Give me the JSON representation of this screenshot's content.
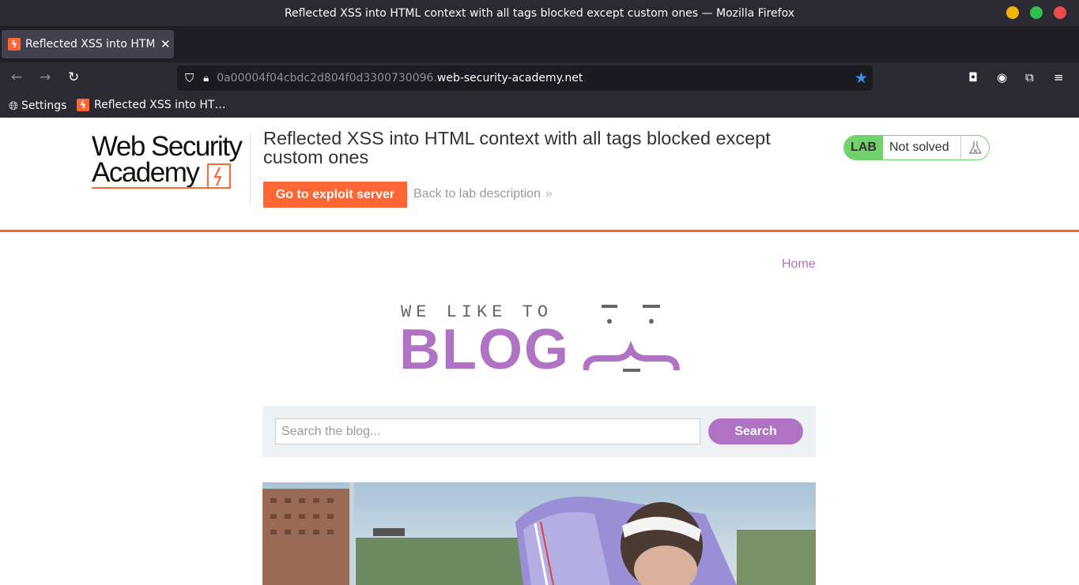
{
  "window": {
    "title": "Reflected XSS into HTML context with all tags blocked except custom ones — Mozilla Firefox"
  },
  "tabs": [
    {
      "label": "Reflected XSS into HTML",
      "active": true
    }
  ],
  "urlbar": {
    "subdomain": "0a00004f04cbdc2d804f0d3300730096.",
    "domain": "web-security-academy.net"
  },
  "bookmarks": [
    {
      "label": "Settings",
      "icon": "globe-icon"
    },
    {
      "label": "Reflected XSS into HT…",
      "icon": "academy-favicon"
    }
  ],
  "lab": {
    "logo_line1": "Web Security",
    "logo_line2": "Academy",
    "title": "Reflected XSS into HTML context with all tags blocked except custom ones",
    "exploit_button": "Go to exploit server",
    "back_link": "Back to lab description",
    "status_tag": "LAB",
    "status": "Not solved"
  },
  "blog": {
    "nav_home": "Home",
    "tagline": "WE LIKE TO",
    "headline": "BLOG",
    "search": {
      "placeholder": "Search the blog...",
      "value": "",
      "button": "Search"
    }
  },
  "colors": {
    "accent_orange": "#ff6633",
    "blog_purple": "#b073c4",
    "lab_green": "#70d16d",
    "browser_chrome": "#2b2a33"
  }
}
